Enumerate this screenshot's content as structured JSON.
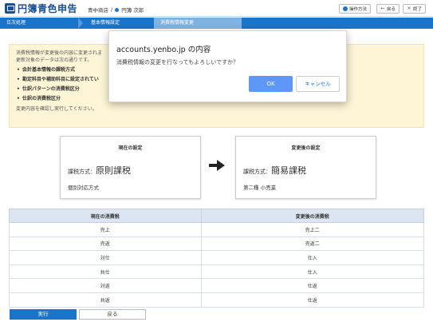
{
  "app": {
    "logo_text": "円簿青色申告",
    "company_name": "青中商店",
    "user_name": "円簿 次郎",
    "header_buttons": {
      "help": "操作方法",
      "back": "戻る",
      "close": "終了"
    }
  },
  "breadcrumb": {
    "steps": [
      "日次処理",
      "基本情報設定",
      "消費税情報変更"
    ]
  },
  "notice": {
    "line1": "消費税情報が変更後の内容に変更されま",
    "line2": "更新対象のデータは次の通りです。",
    "bullets": [
      "会計基本情報の課税方式",
      "勘定科目や補助科目に設定されてい",
      "仕訳パターンの消費税区分",
      "仕訳の消費税区分"
    ],
    "footer": "変更内容を確認し実行してください。"
  },
  "current_setting": {
    "title": "現在の設定",
    "method_label": "課税方式：",
    "method_value": "原則課税",
    "sub": "個別対応方式"
  },
  "new_setting": {
    "title": "変更後の設定",
    "method_label": "課税方式：",
    "method_value": "簡易課税",
    "sub": "第二種 小売業"
  },
  "table": {
    "headers": [
      "現在の消費税",
      "変更後の消費税"
    ],
    "rows": [
      [
        "売上",
        "売上二"
      ],
      [
        "売返",
        "売返二"
      ],
      [
        "対仕",
        "仕入"
      ],
      [
        "共仕",
        "仕入"
      ],
      [
        "対返",
        "仕返"
      ],
      [
        "共返",
        "仕返"
      ]
    ]
  },
  "actions": {
    "run": "実行",
    "back": "戻る"
  },
  "dialog": {
    "title": "accounts.yenbo.jp の内容",
    "message": "消費税情報の変更を行なってもよろしいですか？",
    "ok": "OK",
    "cancel": "キャンセル"
  }
}
